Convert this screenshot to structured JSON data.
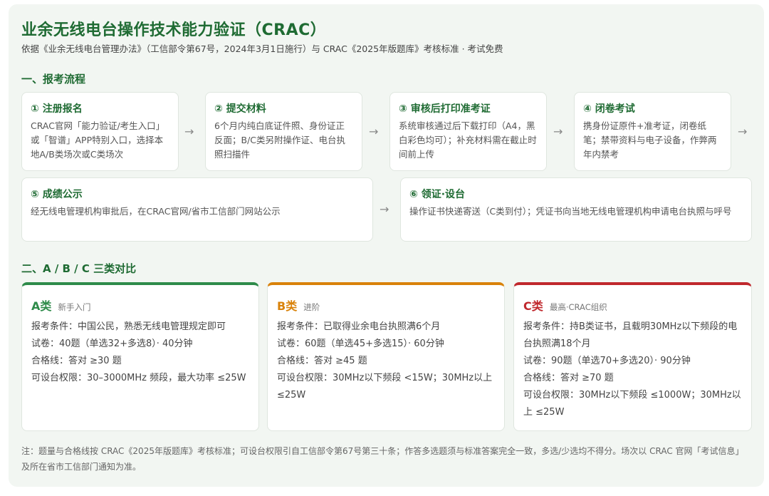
{
  "header": {
    "title": "业余无线电台操作技术能力验证（CRAC）",
    "subtitle": "依据《业余无线电台管理办法》（工信部令第67号，2024年3月1日施行）与 CRAC《2025年版题库》考核标准 · 考试免费"
  },
  "process": {
    "heading": "一、报考流程",
    "arrow": "→",
    "steps": [
      {
        "title": "① 注册报名",
        "body": "CRAC官网「能力验证/考生入口」或「智谱」APP特别入口，选择本地A/B类场次或C类场次"
      },
      {
        "title": "② 提交材料",
        "body": "6个月内纯白底证件照、身份证正反面；B/C类另附操作证、电台执照扫描件"
      },
      {
        "title": "③ 审核后打印准考证",
        "body": "系统审核通过后下载打印（A4，黑白彩色均可）；补充材料需在截止时间前上传"
      },
      {
        "title": "④ 闭卷考试",
        "body": "携身份证原件+准考证，闭卷纸笔；禁带资料与电子设备，作弊两年内禁考"
      },
      {
        "title": "⑤ 成绩公示",
        "body": "经无线电管理机构审批后，在CRAC官网/省市工信部门网站公示"
      },
      {
        "title": "⑥ 领证·设台",
        "body": "操作证书快递寄送（C类到付）；凭证书向当地无线电管理机构申请电台执照与呼号"
      }
    ]
  },
  "compare": {
    "heading": "二、A / B / C 三类对比",
    "cards": [
      {
        "name": "A类",
        "tag": "新手入门",
        "lines": [
          "报考条件：中国公民，熟悉无线电管理规定即可",
          "试卷：40题（单选32+多选8）· 40分钟",
          "合格线：答对 ≥30 题",
          "可设台权限：30–3000MHz 频段，最大功率 ≤25W"
        ]
      },
      {
        "name": "B类",
        "tag": "进阶",
        "lines": [
          "报考条件：已取得业余电台执照满6个月",
          "试卷：60题（单选45+多选15）· 60分钟",
          "合格线：答对 ≥45 题",
          "可设台权限：30MHz以下频段 <15W；30MHz以上 ≤25W"
        ]
      },
      {
        "name": "C类",
        "tag": "最高·CRAC组织",
        "lines": [
          "报考条件：持B类证书，且载明30MHz以下频段的电台执照满18个月",
          "试卷：90题（单选70+多选20）· 90分钟",
          "合格线：答对 ≥70 题",
          "可设台权限：30MHz以下频段 ≤1000W；30MHz以上 ≤25W"
        ]
      }
    ]
  },
  "note": "注：题量与合格线按 CRAC《2025年版题库》考核标准；可设台权限引自工信部令第67号第三十条；作答多选题须与标准答案完全一致，多选/少选均不得分。场次以 CRAC 官网「考试信息」及所在省市工信部门通知为准。",
  "colors": {
    "green": "#1f6b33",
    "class_a": "#2e8b4a",
    "class_b": "#d9820a",
    "class_c": "#c0282d"
  }
}
